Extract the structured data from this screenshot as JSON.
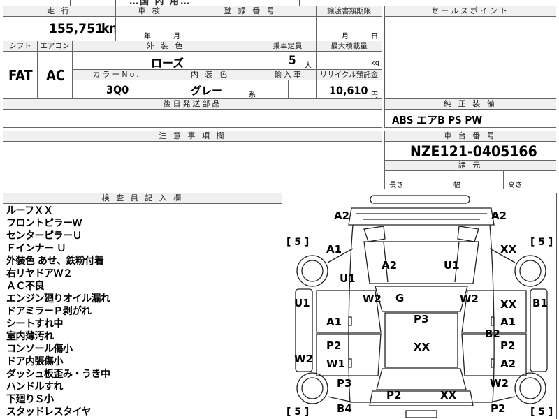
{
  "top_partial": {
    "text": "…国 内 用…"
  },
  "headers": {
    "mileage": "走 行",
    "inspection": "車 検",
    "registration": "登 録 番 号",
    "transfer_deadline": "譲渡書類期限",
    "sales_point": "セールスポイント",
    "shift": "シフト",
    "aircon": "エアコン",
    "exterior_color": "外 装 色",
    "capacity": "乗車定員",
    "max_load": "最大積載量",
    "color_no": "カラーNo.",
    "interior_color": "内 装 色",
    "import": "輸 入 車",
    "recycle": "リサイクル預託金",
    "later_parts": "後日発送部品",
    "standard_equipment": "純 正 装 備",
    "notes": "注 意 事 項 欄",
    "chassis_no": "車 台 番 号",
    "dimensions": "諸 元",
    "inspector_notes": "検 査 員 記 入 欄"
  },
  "values": {
    "mileage": "155,751",
    "mileage_unit": "km",
    "inspection_year_label": "年",
    "inspection_month_label": "月",
    "transfer_month_label": "月",
    "transfer_day_label": "日",
    "shift": "FAT",
    "aircon": "AC",
    "exterior_color": "ローズ",
    "capacity": "5",
    "capacity_unit": "人",
    "max_load_unit": "kg",
    "color_no": "3Q0",
    "interior_color": "グレー",
    "interior_suffix": "系",
    "recycle": "10,610",
    "recycle_unit": "円",
    "standard_equipment": "ABS エアB PS PW",
    "chassis_no": "NZE121-0405166",
    "dim_length": "長さ",
    "dim_width": "幅",
    "dim_height": "高さ"
  },
  "inspector_remarks": [
    "ルーフＸＸ",
    "フロントピラーＷ",
    "センターピラーＵ",
    "Ｆインナー Ｕ",
    "外装色 あせ、鉄粉付着",
    "右リヤドアＷ２",
    "ＡＣ不良",
    "エンジン廻りオイル漏れ",
    "ドアミラーＰ剥がれ",
    "シートすれ中",
    "室内薄汚れ",
    "コンソール傷小",
    "ドア内張傷小",
    "ダッシュ板歪み・うき中",
    "ハンドルすれ",
    "下廻りＳ小",
    "スタッドレスタイヤ"
  ],
  "diagram": {
    "tire_brackets": {
      "front_left": "[ 5 ]",
      "front_right": "[ 5 ]",
      "rear_left": "[ 5 ]",
      "rear_right": "[ 5 ]"
    },
    "marks": {
      "front_bumper_left": "A2",
      "front_bumper_right": "A2",
      "left_front_fender": "A1",
      "right_front_fender": "XX",
      "hood_left": "A2",
      "hood_right": "U1",
      "left_headlight_area": "U1",
      "left_pillar": "W2",
      "windshield": "G",
      "right_pillar": "W2",
      "left_side_inner": "U1",
      "right_side_inner": "XX",
      "right_edge": "B1",
      "left_front_door": "A1",
      "roof": "P3",
      "right_front_door_a": "A1",
      "right_front_door_b": "B2",
      "roof_center": "XX",
      "left_rear_door_a": "P2",
      "left_rear_door_b": "W1",
      "right_rear_door_a": "P2",
      "right_rear_door_b": "A2",
      "left_side_lower": "W2",
      "left_rear_fender": "P3",
      "right_rear_fender": "W2",
      "trunk_left": "P2",
      "trunk_right": "XX",
      "left_rear_bumper": "B4",
      "right_rear_bumper": "P2"
    }
  }
}
